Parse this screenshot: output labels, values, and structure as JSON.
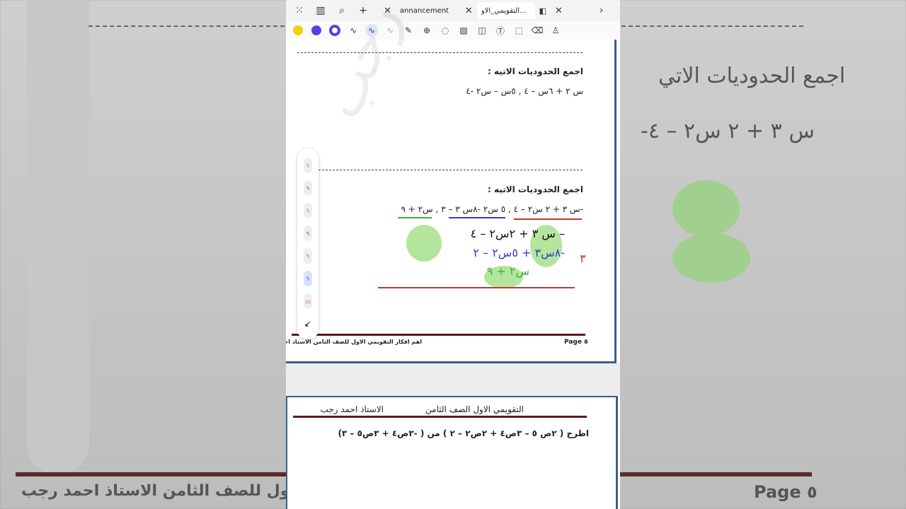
{
  "browser": {
    "tabs": [
      {
        "label": "annancement"
      },
      {
        "label": "التقويمي_الاو..."
      }
    ]
  },
  "background": {
    "heading": "اجمع الحدوديات الاتي",
    "expr": "-س ٣ + ٢ س٢ – ٤",
    "footer_text": "مي الاول   للصف الثامن الاستاذ احمد رجب",
    "page_label": "Page ٥"
  },
  "page1": {
    "q1_heading": "اجمع الحدوديات الاتيه :",
    "q1_expr": "س ٢ + ٦س – ٤   ,   ٥س – س٢ -٤",
    "q2_heading": "اجمع الحدوديات الاتيه :",
    "q2_expr": "-س ٣ + ٢ س٢ – ٤   ,   ٥ س٢ -٨س ٣ – ٣  , س٢ + ٩",
    "hand_row1": "– س ٣ + ٢س٢   – ٤",
    "hand_row2": "-٨س٣ + ٥س٢   – ٢",
    "hand_row3": "س٢          + ٩",
    "hand_side": "٣",
    "footer_left": "اهم افكار التقويمي الاول   للصف الثامن الاستاذ احمد رجب",
    "footer_right": "Page ٥",
    "watermark": "الاستاذ/ احمد رجب"
  },
  "page2": {
    "header_left": "الاستاذ احمد رجب",
    "header_right": "التقويمي الاول  الصف الثامن",
    "question": "اطرح ( ٢ص ٥ – ٣ص٤ + ٢ص٢ – ٢ ) من ( -٣ص٤ + ٣ص٥ – ٣)"
  },
  "colors": {
    "highlight": "#a7e08c",
    "ink_black": "#111111",
    "ink_blue": "#3a3ac9",
    "ink_green": "#3fae3f",
    "ink_red": "#c0392b",
    "frame_blue": "#3b5f8f"
  }
}
